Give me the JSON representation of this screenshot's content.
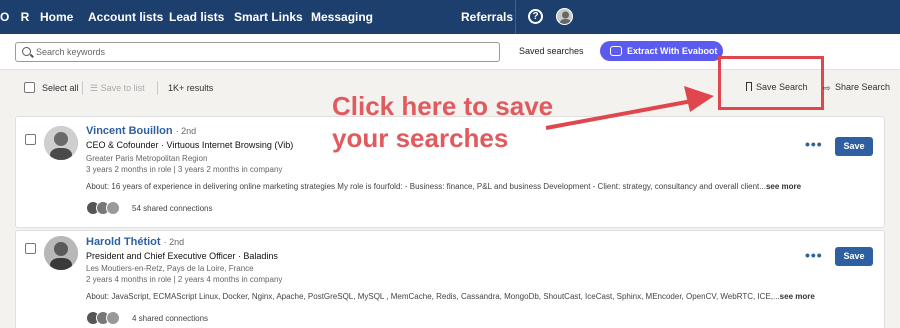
{
  "nav": {
    "brand": "O R",
    "items": [
      "Home",
      "Account lists",
      "Lead lists",
      "Smart Links",
      "Messaging"
    ],
    "referrals": "Referrals",
    "help_icon": "help-circle-icon"
  },
  "search": {
    "placeholder": "Search keywords",
    "saved_searches": "Saved searches",
    "extract_button": "Extract With Evaboot"
  },
  "toolbar": {
    "select_all": "Select all",
    "save_to_list": "Save to list",
    "results": "1K+ results",
    "save_search": "Save Search",
    "share_search": "Share Search"
  },
  "annotation": {
    "line1": "Click here to save",
    "line2": "your searches",
    "color": "#e05a5e"
  },
  "leads": [
    {
      "name": "Vincent Bouillon",
      "degree": "· 2nd",
      "title": "CEO & Cofounder · Virtuous Internet Browsing (Vib)",
      "location": "Greater Paris Metropolitan Region",
      "tenure": "3 years 2 months in role | 3 years 2 months in company",
      "about_label": "About:",
      "about": "16 years of experience in delivering online marketing strategies My role is fourfold: - Business: finance, P&L and business Development - Client: strategy, consultancy and overall client...",
      "see_more": "see more",
      "shared": "54 shared connections",
      "save": "Save"
    },
    {
      "name": "Harold Thétiot",
      "degree": "· 2nd",
      "title": "President and Chief Executive Officer · Baladins",
      "location": "Les Moutiers-en-Retz, Pays de la Loire, France",
      "tenure": "2 years 4 months in role | 2 years 4 months in company",
      "about_label": "About:",
      "about": "JavaScript, ECMAScript Linux, Docker, Nginx, Apache, PostGreSQL, MySQL , MemCache, Redis, Cassandra, MongoDb, ShoutCast, IceCast, Sphinx, MEncoder, OpenCV, WebRTC, ICE,...",
      "see_more": "see more",
      "shared": "4 shared connections",
      "save": "Save"
    }
  ],
  "colors": {
    "nav_bg": "#1d3f6e",
    "accent": "#2e5fa1",
    "evaboot": "#5b5bf0",
    "highlight": "#e0464d"
  }
}
